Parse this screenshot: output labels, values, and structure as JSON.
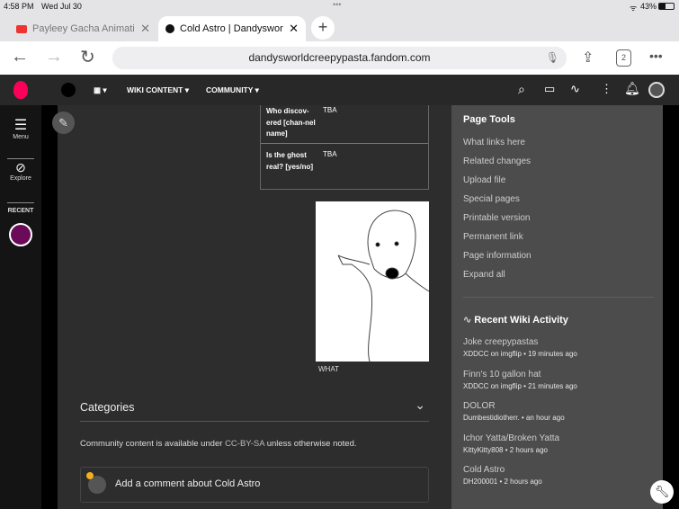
{
  "status": {
    "time": "4:58 PM",
    "date": "Wed Jul 30",
    "battery": "43%"
  },
  "tabs": [
    {
      "label": "Payleey Gacha Animatio"
    },
    {
      "label": "Cold Astro | Dandysworl"
    }
  ],
  "address": {
    "url": "dandysworldcreepypasta.fandom.com",
    "tab_count": "2"
  },
  "header": {
    "nav": [
      "WIKI CONTENT",
      "COMMUNITY"
    ]
  },
  "rail": {
    "menu": "Menu",
    "explore": "Explore",
    "recent": "RECENT"
  },
  "infobox": [
    {
      "label": "Who discov-ered [chan-nel name]",
      "value": "TBA"
    },
    {
      "label": "Is the ghost real? [yes/no]",
      "value": "TBA"
    }
  ],
  "image": {
    "caption": "WHAT"
  },
  "categories": {
    "title": "Categories"
  },
  "license": {
    "pre": "Community content is available under ",
    "link": "CC-BY-SA",
    "post": " unless otherwise noted."
  },
  "comment": {
    "placeholder": "Add a comment about Cold Astro"
  },
  "page_tools": {
    "title": "Page Tools",
    "items": [
      "What links here",
      "Related changes",
      "Upload file",
      "Special pages",
      "Printable version",
      "Permanent link",
      "Page information",
      "Expand all"
    ]
  },
  "activity": {
    "title": "Recent Wiki Activity",
    "items": [
      {
        "title": "Joke creepypastas",
        "meta": "XDDCC on imgflip • 19 minutes ago"
      },
      {
        "title": "Finn's 10 gallon hat",
        "meta": "XDDCC on imgflip • 21 minutes ago"
      },
      {
        "title": "DOLOR",
        "meta": "Dumbestidiotherr. • an hour ago"
      },
      {
        "title": "Ichor Yatta/Broken Yatta",
        "meta": "KittyKitty808 • 2 hours ago"
      },
      {
        "title": "Cold Astro",
        "meta": "DH200001 • 2 hours ago"
      }
    ]
  }
}
